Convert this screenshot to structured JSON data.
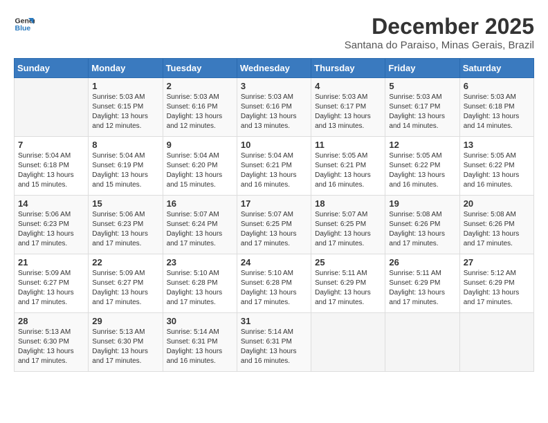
{
  "header": {
    "logo_line1": "General",
    "logo_line2": "Blue",
    "month": "December 2025",
    "location": "Santana do Paraiso, Minas Gerais, Brazil"
  },
  "weekdays": [
    "Sunday",
    "Monday",
    "Tuesday",
    "Wednesday",
    "Thursday",
    "Friday",
    "Saturday"
  ],
  "weeks": [
    [
      {
        "day": "",
        "info": ""
      },
      {
        "day": "1",
        "info": "Sunrise: 5:03 AM\nSunset: 6:15 PM\nDaylight: 13 hours\nand 12 minutes."
      },
      {
        "day": "2",
        "info": "Sunrise: 5:03 AM\nSunset: 6:16 PM\nDaylight: 13 hours\nand 12 minutes."
      },
      {
        "day": "3",
        "info": "Sunrise: 5:03 AM\nSunset: 6:16 PM\nDaylight: 13 hours\nand 13 minutes."
      },
      {
        "day": "4",
        "info": "Sunrise: 5:03 AM\nSunset: 6:17 PM\nDaylight: 13 hours\nand 13 minutes."
      },
      {
        "day": "5",
        "info": "Sunrise: 5:03 AM\nSunset: 6:17 PM\nDaylight: 13 hours\nand 14 minutes."
      },
      {
        "day": "6",
        "info": "Sunrise: 5:03 AM\nSunset: 6:18 PM\nDaylight: 13 hours\nand 14 minutes."
      }
    ],
    [
      {
        "day": "7",
        "info": "Sunrise: 5:04 AM\nSunset: 6:18 PM\nDaylight: 13 hours\nand 15 minutes."
      },
      {
        "day": "8",
        "info": "Sunrise: 5:04 AM\nSunset: 6:19 PM\nDaylight: 13 hours\nand 15 minutes."
      },
      {
        "day": "9",
        "info": "Sunrise: 5:04 AM\nSunset: 6:20 PM\nDaylight: 13 hours\nand 15 minutes."
      },
      {
        "day": "10",
        "info": "Sunrise: 5:04 AM\nSunset: 6:21 PM\nDaylight: 13 hours\nand 16 minutes."
      },
      {
        "day": "11",
        "info": "Sunrise: 5:05 AM\nSunset: 6:21 PM\nDaylight: 13 hours\nand 16 minutes."
      },
      {
        "day": "12",
        "info": "Sunrise: 5:05 AM\nSunset: 6:22 PM\nDaylight: 13 hours\nand 16 minutes."
      },
      {
        "day": "13",
        "info": "Sunrise: 5:05 AM\nSunset: 6:22 PM\nDaylight: 13 hours\nand 16 minutes."
      }
    ],
    [
      {
        "day": "14",
        "info": "Sunrise: 5:06 AM\nSunset: 6:23 PM\nDaylight: 13 hours\nand 17 minutes."
      },
      {
        "day": "15",
        "info": "Sunrise: 5:06 AM\nSunset: 6:23 PM\nDaylight: 13 hours\nand 17 minutes."
      },
      {
        "day": "16",
        "info": "Sunrise: 5:07 AM\nSunset: 6:24 PM\nDaylight: 13 hours\nand 17 minutes."
      },
      {
        "day": "17",
        "info": "Sunrise: 5:07 AM\nSunset: 6:25 PM\nDaylight: 13 hours\nand 17 minutes."
      },
      {
        "day": "18",
        "info": "Sunrise: 5:07 AM\nSunset: 6:25 PM\nDaylight: 13 hours\nand 17 minutes."
      },
      {
        "day": "19",
        "info": "Sunrise: 5:08 AM\nSunset: 6:26 PM\nDaylight: 13 hours\nand 17 minutes."
      },
      {
        "day": "20",
        "info": "Sunrise: 5:08 AM\nSunset: 6:26 PM\nDaylight: 13 hours\nand 17 minutes."
      }
    ],
    [
      {
        "day": "21",
        "info": "Sunrise: 5:09 AM\nSunset: 6:27 PM\nDaylight: 13 hours\nand 17 minutes."
      },
      {
        "day": "22",
        "info": "Sunrise: 5:09 AM\nSunset: 6:27 PM\nDaylight: 13 hours\nand 17 minutes."
      },
      {
        "day": "23",
        "info": "Sunrise: 5:10 AM\nSunset: 6:28 PM\nDaylight: 13 hours\nand 17 minutes."
      },
      {
        "day": "24",
        "info": "Sunrise: 5:10 AM\nSunset: 6:28 PM\nDaylight: 13 hours\nand 17 minutes."
      },
      {
        "day": "25",
        "info": "Sunrise: 5:11 AM\nSunset: 6:29 PM\nDaylight: 13 hours\nand 17 minutes."
      },
      {
        "day": "26",
        "info": "Sunrise: 5:11 AM\nSunset: 6:29 PM\nDaylight: 13 hours\nand 17 minutes."
      },
      {
        "day": "27",
        "info": "Sunrise: 5:12 AM\nSunset: 6:29 PM\nDaylight: 13 hours\nand 17 minutes."
      }
    ],
    [
      {
        "day": "28",
        "info": "Sunrise: 5:13 AM\nSunset: 6:30 PM\nDaylight: 13 hours\nand 17 minutes."
      },
      {
        "day": "29",
        "info": "Sunrise: 5:13 AM\nSunset: 6:30 PM\nDaylight: 13 hours\nand 17 minutes."
      },
      {
        "day": "30",
        "info": "Sunrise: 5:14 AM\nSunset: 6:31 PM\nDaylight: 13 hours\nand 16 minutes."
      },
      {
        "day": "31",
        "info": "Sunrise: 5:14 AM\nSunset: 6:31 PM\nDaylight: 13 hours\nand 16 minutes."
      },
      {
        "day": "",
        "info": ""
      },
      {
        "day": "",
        "info": ""
      },
      {
        "day": "",
        "info": ""
      }
    ]
  ]
}
